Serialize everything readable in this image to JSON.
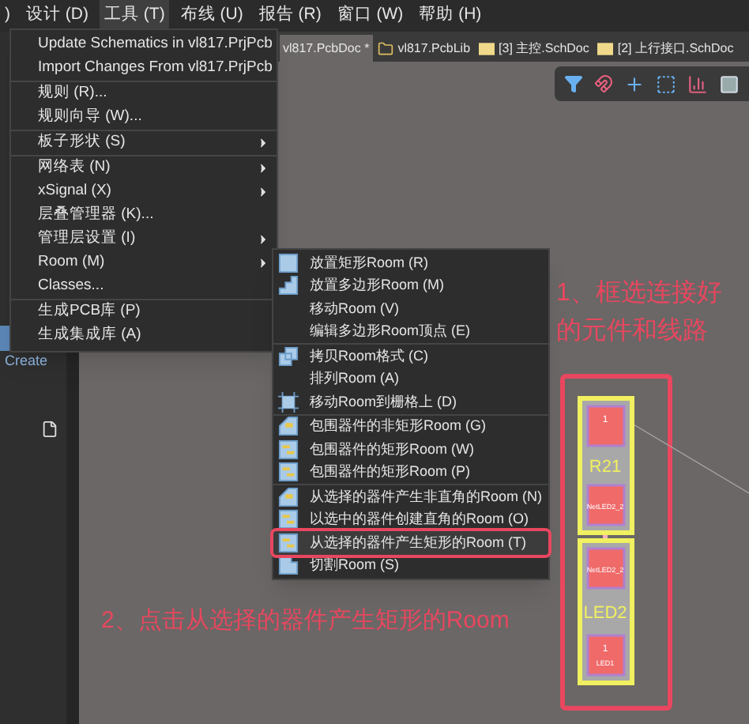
{
  "menu_bar": [
    {
      "label": ")",
      "selected": false
    },
    {
      "label": "设计 (D)",
      "selected": false
    },
    {
      "label": "工具 (T)",
      "selected": true
    },
    {
      "label": "布线 (U)",
      "selected": false
    },
    {
      "label": "报告 (R)",
      "selected": false
    },
    {
      "label": "窗口 (W)",
      "selected": false
    },
    {
      "label": "帮助 (H)",
      "selected": false
    }
  ],
  "tabs": [
    {
      "label": "vl817.PcbDoc *",
      "selected": true,
      "kind": "pcb"
    },
    {
      "label": "vl817.PcbLib",
      "selected": false,
      "kind": "library"
    },
    {
      "label": "[3] 主控.SchDoc",
      "selected": false,
      "kind": "sheet"
    },
    {
      "label": "[2] 上行接口.SchDoc",
      "selected": false,
      "kind": "sheet"
    }
  ],
  "left_panel": {
    "button": "Create"
  },
  "tools_menu": [
    [
      {
        "label": "Update Schematics in vl817.PrjPcb",
        "submenu": false
      },
      {
        "label": "Import Changes From vl817.PrjPcb",
        "submenu": false
      }
    ],
    [
      {
        "label": "规则 (R)...",
        "submenu": false
      },
      {
        "label": "规则向导 (W)...",
        "submenu": false
      }
    ],
    [
      {
        "label": "板子形状 (S)",
        "submenu": true
      }
    ],
    [
      {
        "label": "网络表 (N)",
        "submenu": true
      },
      {
        "label": "xSignal (X)",
        "submenu": true
      },
      {
        "label": "层叠管理器 (K)...",
        "submenu": false
      },
      {
        "label": "管理层设置 (I)",
        "submenu": true
      },
      {
        "label": "Room (M)",
        "submenu": true
      },
      {
        "label": "Classes...",
        "submenu": false
      }
    ],
    [
      {
        "label": "生成PCB库 (P)",
        "submenu": false
      },
      {
        "label": "生成集成库 (A)",
        "submenu": false
      }
    ]
  ],
  "room_menu": [
    [
      {
        "label": "放置矩形Room (R)",
        "kind": "rect",
        "selected": false
      },
      {
        "label": "放置多边形Room (M)",
        "kind": "poly",
        "selected": false
      },
      {
        "label": "移动Room (V)",
        "kind": "plain",
        "selected": false
      },
      {
        "label": "编辑多边形Room顶点 (E)",
        "kind": "plain",
        "selected": false
      }
    ],
    [
      {
        "label": "拷贝Room格式 (C)",
        "kind": "copy",
        "selected": false
      },
      {
        "label": "排列Room (A)",
        "kind": "plain",
        "selected": false
      },
      {
        "label": "移动Room到栅格上 (D)",
        "kind": "grid",
        "selected": false
      }
    ],
    [
      {
        "label": "包围器件的非矩形Room (G)",
        "kind": "nonrect",
        "selected": false
      },
      {
        "label": "包围器件的矩形Room (W)",
        "kind": "enclose",
        "selected": false
      },
      {
        "label": "包围器件的矩形Room (P)",
        "kind": "enclose",
        "selected": false
      }
    ],
    [
      {
        "label": "从选择的器件产生非直角的Room (N)",
        "kind": "nonrect",
        "selected": false
      },
      {
        "label": "以选中的器件创建直角的Room (O)",
        "kind": "enclose",
        "selected": false
      },
      {
        "label": "从选择的器件产生矩形的Room (T)",
        "kind": "enclose",
        "selected": true
      },
      {
        "label": "切割Room (S)",
        "kind": "cut",
        "selected": false
      }
    ]
  ],
  "annotations": [
    "1、框选连接好",
    "的元件和线路",
    "2、点击从选择的器件产生矩形的Room"
  ],
  "pcb": {
    "components": [
      {
        "designator": "R21",
        "pads": [
          {
            "number": "1"
          },
          {
            "net": "NetLED2_2"
          }
        ]
      },
      {
        "designator": "LED2",
        "pads": [
          {
            "net": "NetLED2_2"
          },
          {
            "number": "1",
            "net": "LED1"
          }
        ]
      }
    ]
  }
}
